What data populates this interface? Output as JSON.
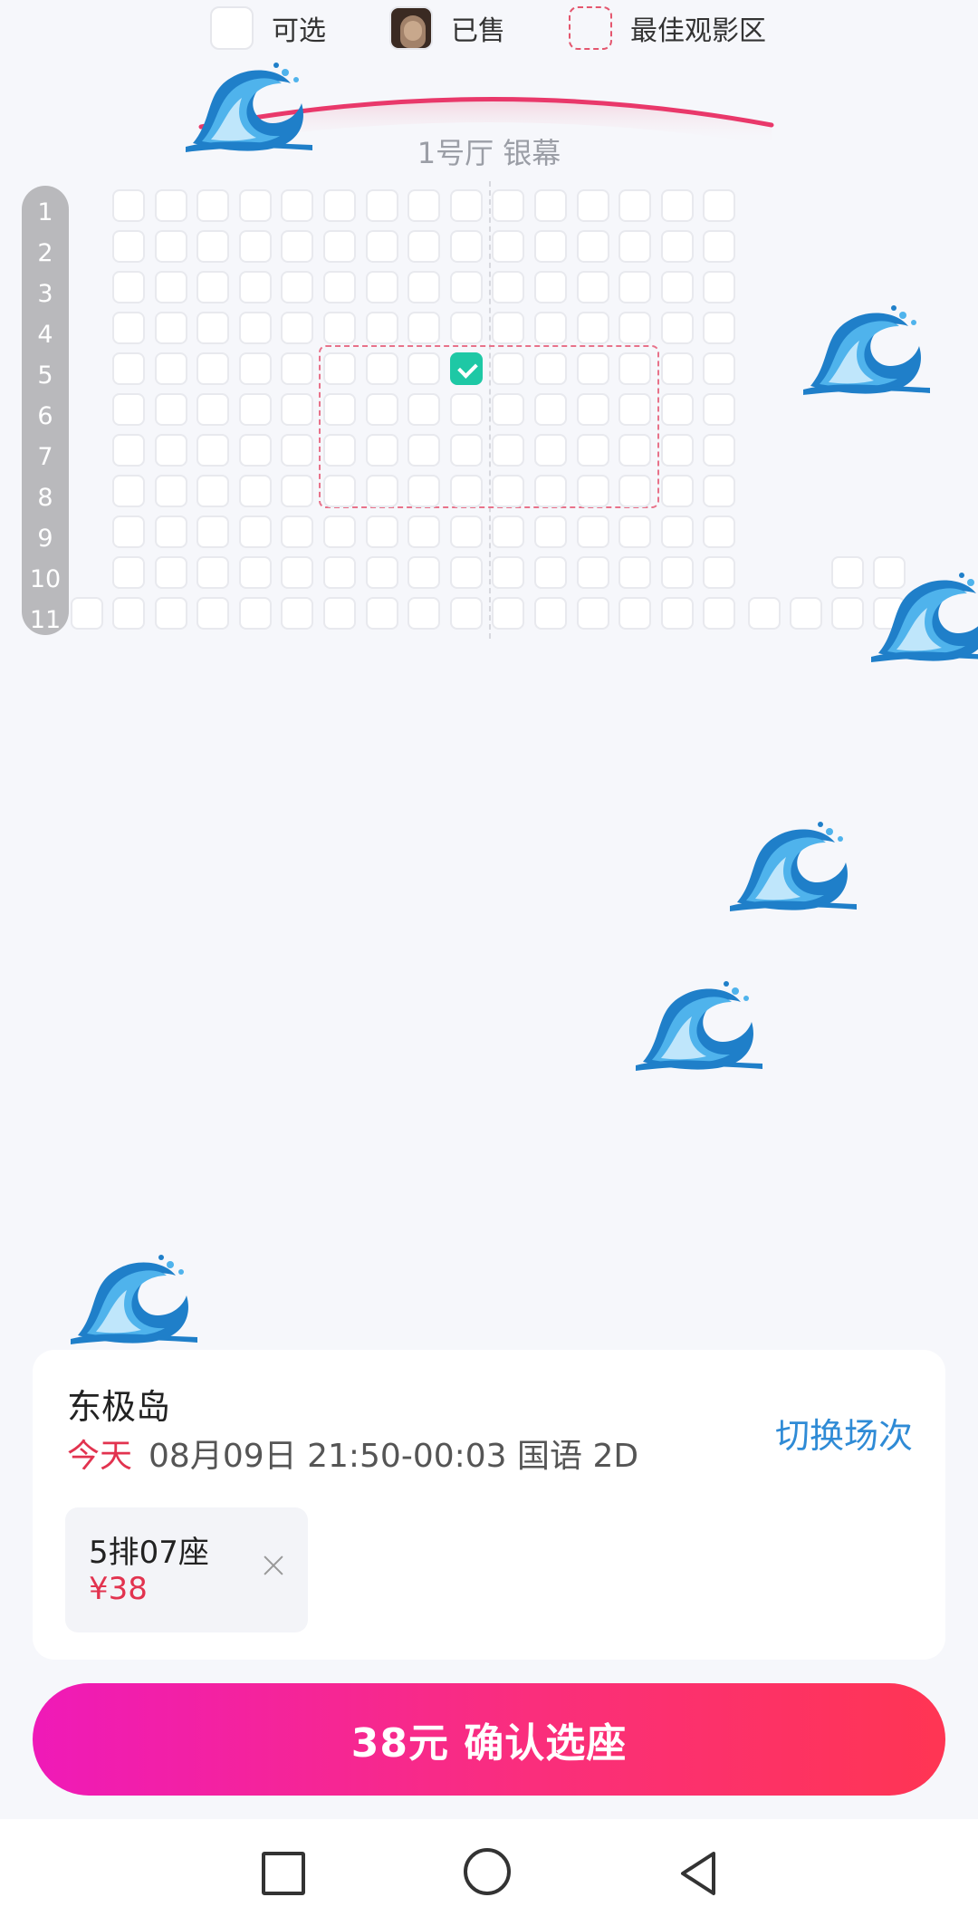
{
  "legend": {
    "available_label": "可选",
    "sold_label": "已售",
    "best_zone_label": "最佳观影区"
  },
  "screen": {
    "label": "1号厅 银幕"
  },
  "seat_map": {
    "rows": [
      "1",
      "2",
      "3",
      "4",
      "5",
      "6",
      "7",
      "8",
      "9",
      "10",
      "11"
    ],
    "selected_seat": "5排07座"
  },
  "decoration": {
    "wave_icon": "wave-icon",
    "count": 6
  },
  "movie": {
    "title": "东极岛",
    "day": "今天",
    "showtime": "08月09日 21:50-00:03 国语 2D",
    "switch_label": "切换场次"
  },
  "ticket": {
    "seat": "5排07座",
    "price": "¥38"
  },
  "confirm": {
    "label": "38元 确认选座"
  },
  "nav": {
    "icons": [
      "recent-apps-icon",
      "home-icon",
      "back-icon"
    ]
  },
  "colors": {
    "accent_red": "#e2334f",
    "link_blue": "#2f8bd6",
    "selected_green": "#1ec8a5",
    "button_gradient_start": "#ef1ab8",
    "button_gradient_end": "#ff3553"
  }
}
